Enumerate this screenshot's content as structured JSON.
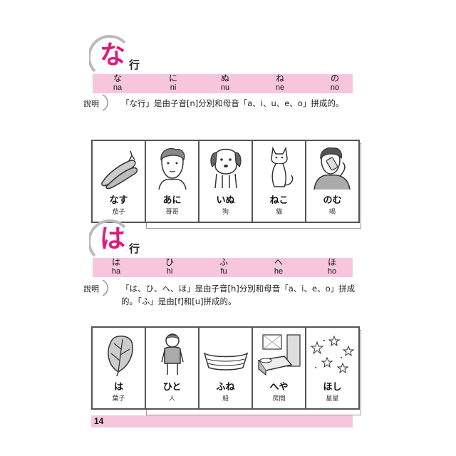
{
  "sections": [
    {
      "kana": "な",
      "gyo": "行",
      "row": [
        {
          "kana": "な",
          "romaji": "na"
        },
        {
          "kana": "に",
          "romaji": "ni"
        },
        {
          "kana": "ぬ",
          "romaji": "nu"
        },
        {
          "kana": "ね",
          "romaji": "ne"
        },
        {
          "kana": "の",
          "romaji": "no"
        }
      ],
      "explain_label": "說明",
      "explain_text": "「な行」是由子音[n]分別和母音「a、i、u、e、o」拼成的。",
      "cards": [
        {
          "icon": "eggplant-icon",
          "word": "なす",
          "meaning": "茄子"
        },
        {
          "icon": "boy-icon",
          "word": "あに",
          "meaning": "哥哥"
        },
        {
          "icon": "dog-icon",
          "word": "いぬ",
          "meaning": "狗"
        },
        {
          "icon": "cat-icon",
          "word": "ねこ",
          "meaning": "貓"
        },
        {
          "icon": "drinking-man-icon",
          "word": "のむ",
          "meaning": "喝"
        }
      ]
    },
    {
      "kana": "は",
      "gyo": "行",
      "row": [
        {
          "kana": "は",
          "romaji": "ha"
        },
        {
          "kana": "ひ",
          "romaji": "hi"
        },
        {
          "kana": "ふ",
          "romaji": "fu"
        },
        {
          "kana": "へ",
          "romaji": "he"
        },
        {
          "kana": "ほ",
          "romaji": "ho"
        }
      ],
      "explain_label": "說明",
      "explain_text": "「は、ひ、へ、ほ」是由子音[h]分別和母音「a、i、e、o」拼成的。「ふ」是由[f]和[u]拼成的。",
      "cards": [
        {
          "icon": "leaf-icon",
          "word": "は",
          "meaning": "葉子"
        },
        {
          "icon": "person-icon",
          "word": "ひと",
          "meaning": "人"
        },
        {
          "icon": "boat-icon",
          "word": "ふね",
          "meaning": "船"
        },
        {
          "icon": "bedroom-icon",
          "word": "へや",
          "meaning": "房間"
        },
        {
          "icon": "stars-icon",
          "word": "ほし",
          "meaning": "星星"
        }
      ]
    }
  ],
  "page_number": "14"
}
